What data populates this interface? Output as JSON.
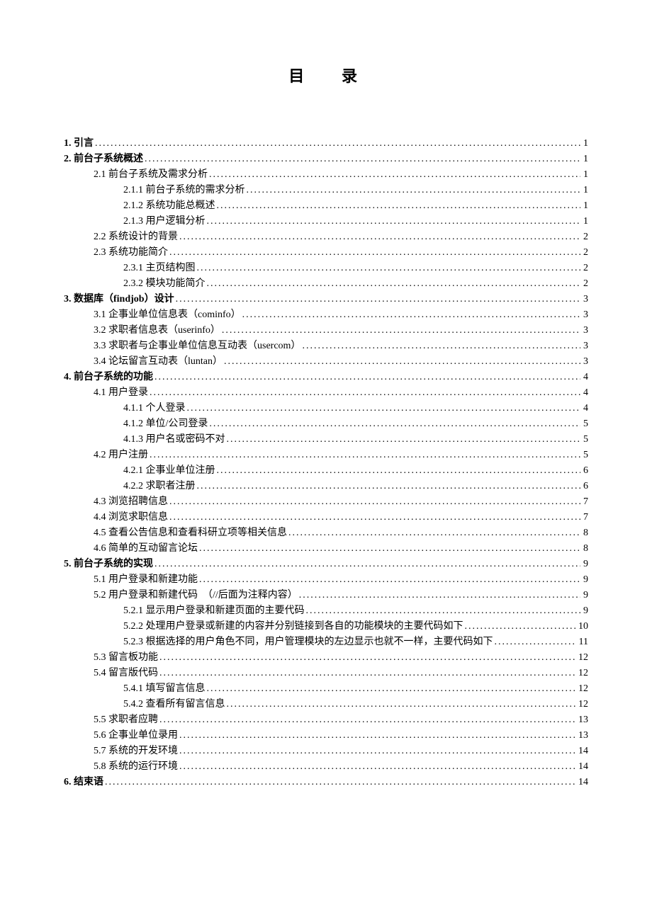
{
  "title_left": "目",
  "title_right": "录",
  "toc": [
    {
      "level": 1,
      "bold": true,
      "label": "1. 引言",
      "page": "1"
    },
    {
      "level": 1,
      "bold": true,
      "label": "2. 前台子系统概述",
      "page": "1"
    },
    {
      "level": 2,
      "bold": false,
      "label": "2.1 前台子系统及需求分析",
      "page": "1"
    },
    {
      "level": 3,
      "bold": false,
      "label": "2.1.1 前台子系统的需求分析",
      "page": "1"
    },
    {
      "level": 3,
      "bold": false,
      "label": "2.1.2 系统功能总概述",
      "page": "1"
    },
    {
      "level": 3,
      "bold": false,
      "label": "2.1.3 用户逻辑分析",
      "page": "1"
    },
    {
      "level": 2,
      "bold": false,
      "label": "2.2 系统设计的背景",
      "page": "2"
    },
    {
      "level": 2,
      "bold": false,
      "label": "2.3 系统功能简介",
      "page": "2"
    },
    {
      "level": 3,
      "bold": false,
      "label": "2.3.1 主页结构图",
      "page": "2"
    },
    {
      "level": 3,
      "bold": false,
      "label": "2.3.2 模块功能简介",
      "page": "2"
    },
    {
      "level": 1,
      "bold": true,
      "label": "3. 数据库（findjob）设计",
      "page": "3"
    },
    {
      "level": 2,
      "bold": false,
      "label": "3.1 企事业单位信息表（cominfo）",
      "page": "3"
    },
    {
      "level": 2,
      "bold": false,
      "label": "3.2 求职者信息表（userinfo）",
      "page": "3"
    },
    {
      "level": 2,
      "bold": false,
      "label": "3.3 求职者与企事业单位信息互动表（usercom）",
      "page": "3"
    },
    {
      "level": 2,
      "bold": false,
      "label": "3.4 论坛留言互动表（luntan）",
      "page": "3"
    },
    {
      "level": 1,
      "bold": true,
      "label": "4. 前台子系统的功能",
      "page": "4"
    },
    {
      "level": 2,
      "bold": false,
      "label": "4.1 用户登录",
      "page": "4"
    },
    {
      "level": 3,
      "bold": false,
      "label": "4.1.1 个人登录",
      "page": "4"
    },
    {
      "level": 3,
      "bold": false,
      "label": "4.1.2 单位/公司登录",
      "page": "5"
    },
    {
      "level": 3,
      "bold": false,
      "label": "4.1.3 用户名或密码不对",
      "page": "5"
    },
    {
      "level": 2,
      "bold": false,
      "label": "4.2 用户注册",
      "page": "5"
    },
    {
      "level": 3,
      "bold": false,
      "label": "4.2.1 企事业单位注册",
      "page": "6"
    },
    {
      "level": 3,
      "bold": false,
      "label": "4.2.2 求职者注册",
      "page": "6"
    },
    {
      "level": 2,
      "bold": false,
      "label": "4.3 浏览招聘信息",
      "page": "7"
    },
    {
      "level": 2,
      "bold": false,
      "label": "4.4 浏览求职信息",
      "page": "7"
    },
    {
      "level": 2,
      "bold": false,
      "label": "4.5 查看公告信息和查看科研立项等相关信息",
      "page": "8"
    },
    {
      "level": 2,
      "bold": false,
      "label": "4.6 简单的互动留言论坛",
      "page": "8"
    },
    {
      "level": 1,
      "bold": true,
      "label": "5. 前台子系统的实现",
      "page": "9"
    },
    {
      "level": 2,
      "bold": false,
      "label": "5.1 用户登录和新建功能",
      "page": "9"
    },
    {
      "level": 2,
      "bold": false,
      "label": "5.2 用户登录和新建代码　（//后面为注释内容）",
      "page": "9"
    },
    {
      "level": 3,
      "bold": false,
      "label": "5.2.1 显示用户登录和新建页面的主要代码",
      "page": "9"
    },
    {
      "level": 3,
      "bold": false,
      "label": "5.2.2 处理用户登录或新建的内容并分别链接到各自的功能模块的主要代码如下",
      "page": "10"
    },
    {
      "level": 3,
      "bold": false,
      "label": "5.2.3 根据选择的用户角色不同，用户管理模块的左边显示也就不一样，主要代码如下",
      "page": "11"
    },
    {
      "level": 2,
      "bold": false,
      "label": "5.3 留言板功能",
      "page": "12"
    },
    {
      "level": 2,
      "bold": false,
      "label": "5.4 留言版代码",
      "page": "12"
    },
    {
      "level": 3,
      "bold": false,
      "label": "5.4.1 填写留言信息",
      "page": "12"
    },
    {
      "level": 3,
      "bold": false,
      "label": "5.4.2 查看所有留言信息",
      "page": "12"
    },
    {
      "level": 2,
      "bold": false,
      "label": "5.5 求职者应聘",
      "page": "13"
    },
    {
      "level": 2,
      "bold": false,
      "label": "5.6 企事业单位录用",
      "page": "13"
    },
    {
      "level": 2,
      "bold": false,
      "label": "5.7 系统的开发环境",
      "page": "14"
    },
    {
      "level": 2,
      "bold": false,
      "label": "5.8 系统的运行环境",
      "page": "14"
    },
    {
      "level": 1,
      "bold": true,
      "label": "6. 结束语",
      "page": "14"
    }
  ]
}
